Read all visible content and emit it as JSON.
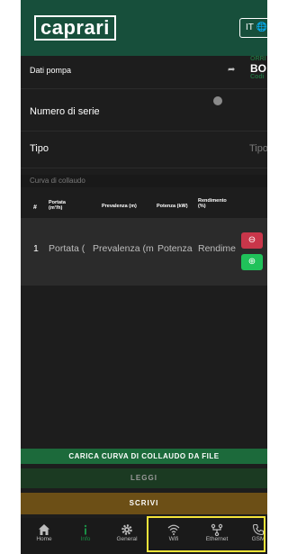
{
  "header": {
    "logo_text": "caprari",
    "lang_label": "IT",
    "pump_tag_line1": "ORRI",
    "pump_tag_line2": "BO",
    "pump_tag_line3": "Codi"
  },
  "sections": {
    "dati_pompa": "Dati pompa",
    "numero_di_serie": "Numero di serie",
    "tipo": "Tipo",
    "tipo_value": "Tipo",
    "curva_di_collaudo": "Curva di collaudo"
  },
  "table": {
    "headers": [
      "#",
      "Portata (m³/h)",
      "Prevalenza (m)",
      "Potenza (kW)",
      "Rendimento (%)"
    ],
    "header_portata_1": "Portata",
    "header_portata_2": "(m³/h)",
    "header_rendimento_1": "Rendimento",
    "header_rendimento_2": "(%)",
    "rows": [
      {
        "index": "1",
        "portata": "Portata (",
        "prevalenza": "Prevalenza (m",
        "potenza": "Potenza",
        "rendimento": "Rendime"
      }
    ]
  },
  "buttons": {
    "carica": "CARICA CURVA DI COLLAUDO DA FILE",
    "leggi": "LEGGI",
    "scrivi": "SCRIVI"
  },
  "nav": {
    "items": [
      {
        "label": "Home",
        "icon": "home-icon"
      },
      {
        "label": "Info",
        "icon": "info-icon"
      },
      {
        "label": "General",
        "icon": "gear-icon"
      },
      {
        "label": "Wifi",
        "icon": "wifi-icon"
      },
      {
        "label": "Ethernet",
        "icon": "ethernet-icon"
      },
      {
        "label": "GSM",
        "icon": "phone-icon"
      }
    ]
  },
  "colors": {
    "header_bg": "#174f3b",
    "page_bg": "#1d1d1d",
    "accent_green": "#20c25a",
    "danger_red": "#c9364a",
    "scrivi_gold": "#6c4f16",
    "highlight_yellow": "#f4e43a"
  }
}
